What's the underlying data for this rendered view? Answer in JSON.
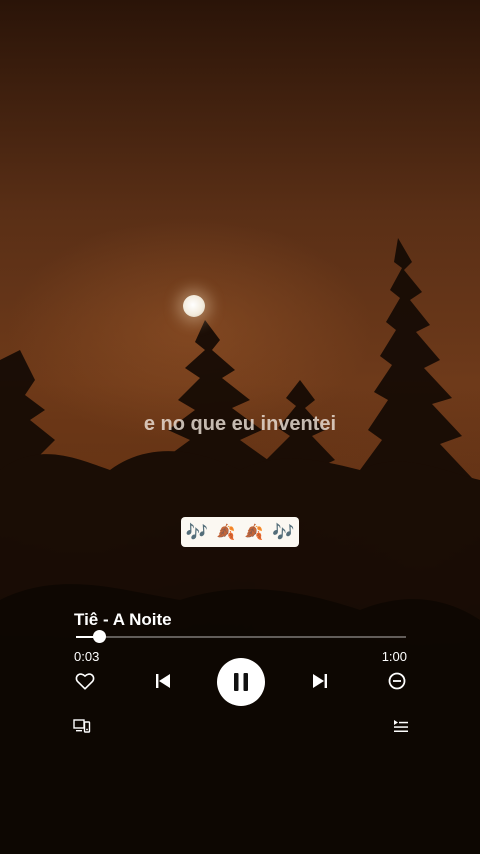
{
  "lyric": "e no que eu inventei",
  "emoji_badge": {
    "items": [
      "🎶",
      "🍂",
      "🍂",
      "🎶"
    ]
  },
  "player": {
    "track_title": "Tiê - A Noite",
    "elapsed": "0:03",
    "duration": "1:00",
    "progress_fraction": 0.07,
    "controls": {
      "like": "heart-icon",
      "previous": "skip-previous-icon",
      "play_pause": "pause-icon",
      "next": "skip-next-icon",
      "remove": "minus-circle-icon",
      "device": "connect-device-icon",
      "queue": "queue-icon"
    }
  },
  "colors": {
    "accent": "#ffffff",
    "badge_bg": "#fbf8f2",
    "sky_orange": "#6e3a1a"
  }
}
